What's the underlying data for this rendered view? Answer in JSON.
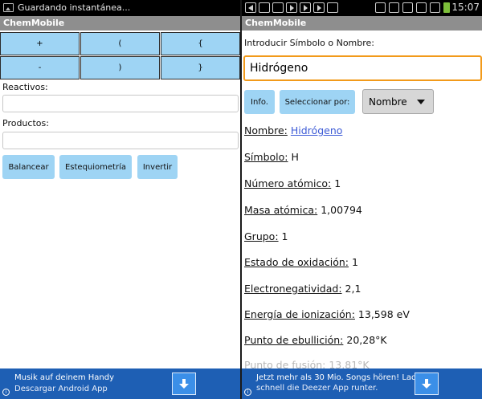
{
  "left": {
    "status_text": "Guardando instantánea...",
    "app_title": "ChemMobile",
    "operators": [
      "+",
      "(",
      "{",
      "-",
      ")",
      "}"
    ],
    "reactivos_label": "Reactivos:",
    "productos_label": "Productos:",
    "reactivos_value": "",
    "productos_value": "",
    "buttons": {
      "balancear": "Balancear",
      "estequiometria": "Estequiometría",
      "invertir": "Invertir"
    },
    "ad": {
      "title": "Musik auf deinem Handy",
      "subtitle": "Descargar Android App",
      "info": "i"
    }
  },
  "right": {
    "app_title": "ChemMobile",
    "clock": "15:07",
    "prompt": "Introducir Símbolo o Nombre:",
    "search_value": "Hidrógeno",
    "info_button": "Info.",
    "select_by_button": "Seleccionar por:",
    "select_value": "Nombre",
    "properties": [
      {
        "key": "Nombre:",
        "value": "Hidrógeno"
      },
      {
        "key": "Símbolo:",
        "value": "H"
      },
      {
        "key": "Número atómico:",
        "value": "1"
      },
      {
        "key": "Masa atómica:",
        "value": "1,00794"
      },
      {
        "key": "Grupo:",
        "value": "1"
      },
      {
        "key": "Estado de oxidación:",
        "value": "1"
      },
      {
        "key": "Electronegatividad:",
        "value": "2,1"
      },
      {
        "key": "Energía de ionización:",
        "value": "13,598 eV"
      },
      {
        "key": "Punto de ebullición:",
        "value": "20,28°K"
      },
      {
        "key": "Punto de fusión:",
        "value": "13,81°K"
      }
    ],
    "ad": {
      "line1": "Jetzt mehr als 30 Mio. Songs hören! Lade",
      "line2": "schnell die Deezer App runter.",
      "info": "i"
    }
  },
  "colors": {
    "button": "#9ed4f4",
    "focus_border": "#f29a1a",
    "link": "#3d5bd6",
    "ad_background": "#1e5fb4",
    "title_bar": "#8e8e8e"
  }
}
